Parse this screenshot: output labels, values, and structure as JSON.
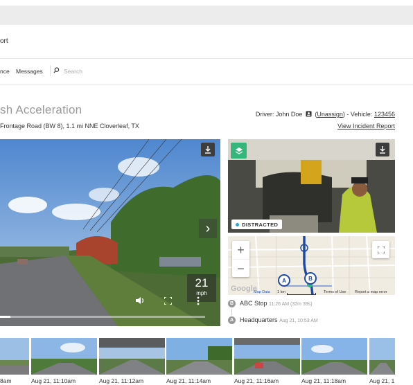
{
  "header": {
    "title_fragment": "ort"
  },
  "nav": {
    "items": [
      "nce",
      "Messages"
    ],
    "search_placeholder": "Search"
  },
  "event": {
    "title": "sh Acceleration",
    "location": "Frontage Road (BW 8), 1.1 mi NNE Cloverleaf, TX"
  },
  "driver": {
    "prefix": "Driver: John Doe",
    "unassign": "Unassign",
    "vehicle_prefix": "- Vehicle:",
    "vehicle_id": "123456",
    "incident_link": "View Incident Report"
  },
  "video": {
    "speed_value": "21",
    "speed_unit": "mph",
    "progress": 0.05,
    "cabin_tag": "DISTRACTED"
  },
  "map": {
    "zoom_in": "+",
    "zoom_out": "−",
    "footer": {
      "attribution": "Map Data",
      "scale": "1 km",
      "terms": "Terms of Use",
      "report": "Report a map error"
    },
    "marker_a": "A",
    "marker_b": "B"
  },
  "stops": [
    {
      "badge": "B",
      "name": "ABC Stop",
      "time": "11:26 AM (32m 39s)"
    },
    {
      "badge": "A",
      "name": "Headquarters",
      "time": "Aug 21, 10:53 AM"
    }
  ],
  "thumbnails": [
    {
      "label": "8am"
    },
    {
      "label": "Aug 21, 11:10am"
    },
    {
      "label": "Aug 21, 11:12am"
    },
    {
      "label": "Aug 21, 11:14am"
    },
    {
      "label": "Aug 21, 11:16am"
    },
    {
      "label": "Aug 21, 11:18am"
    },
    {
      "label": "Aug 21, 1"
    }
  ],
  "colors": {
    "accent_green": "#36b67a",
    "route_blue": "#1f49a8",
    "tag_dot": "#2aa7c7"
  }
}
